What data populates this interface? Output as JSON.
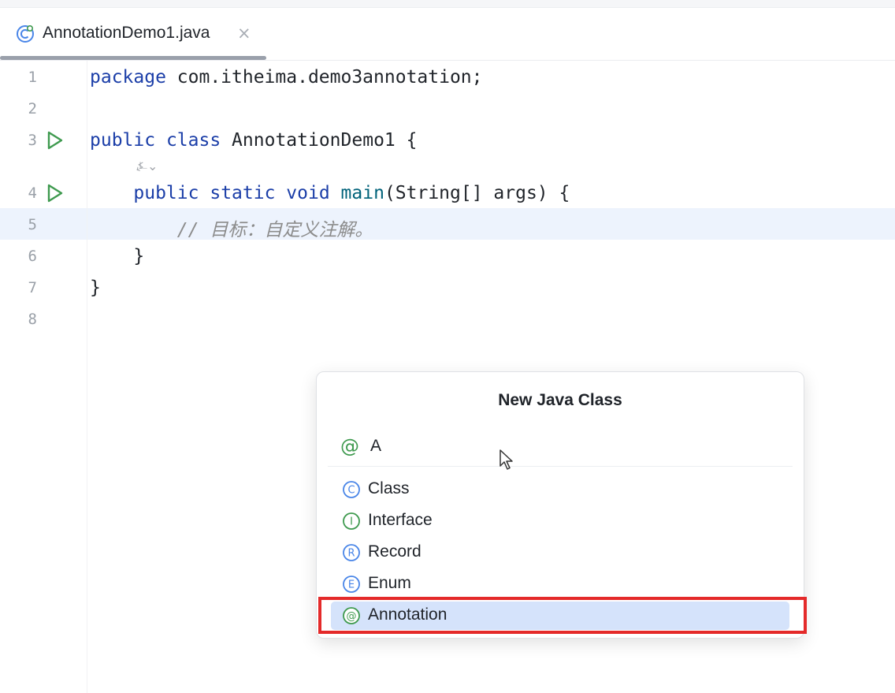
{
  "tab": {
    "title": "AnnotationDemo1.java",
    "close_glyph": "×",
    "icon": "java-class-icon"
  },
  "editor": {
    "line_numbers": [
      "1",
      "2",
      "3",
      "4",
      "5",
      "6",
      "7",
      "8"
    ],
    "lines": {
      "l1_kw": "package",
      "l1_rest": " com.itheima.demo3annotation;",
      "l3_kw1": "public",
      "l3_kw2": "class",
      "l3_rest": " AnnotationDemo1 {",
      "l4_kw1": "public",
      "l4_kw2": "static",
      "l4_kw3": "void",
      "l4_fn": "main",
      "l4_rest": "(String[] args) {",
      "l5_comment": "// 目标：自定义注解。",
      "l6": "}",
      "l7": "}"
    },
    "hint_glyph": "⍼⌄",
    "current_line": "5"
  },
  "popup": {
    "title": "New Java Class",
    "name_icon": "@",
    "name_value": "A",
    "kinds": [
      {
        "label": "Class",
        "letter": "C",
        "color": "#4a86e8"
      },
      {
        "label": "Interface",
        "letter": "I",
        "color": "#3f9a4f"
      },
      {
        "label": "Record",
        "letter": "R",
        "color": "#4a86e8"
      },
      {
        "label": "Enum",
        "letter": "E",
        "color": "#4a86e8"
      },
      {
        "label": "Annotation",
        "letter": "@",
        "color": "#3f9a4f"
      }
    ],
    "selected_kind": "Annotation"
  },
  "colors": {
    "keyword": "#1b3ea8",
    "highlight_box": "#e42a2a",
    "selection": "#d5e3fb"
  }
}
